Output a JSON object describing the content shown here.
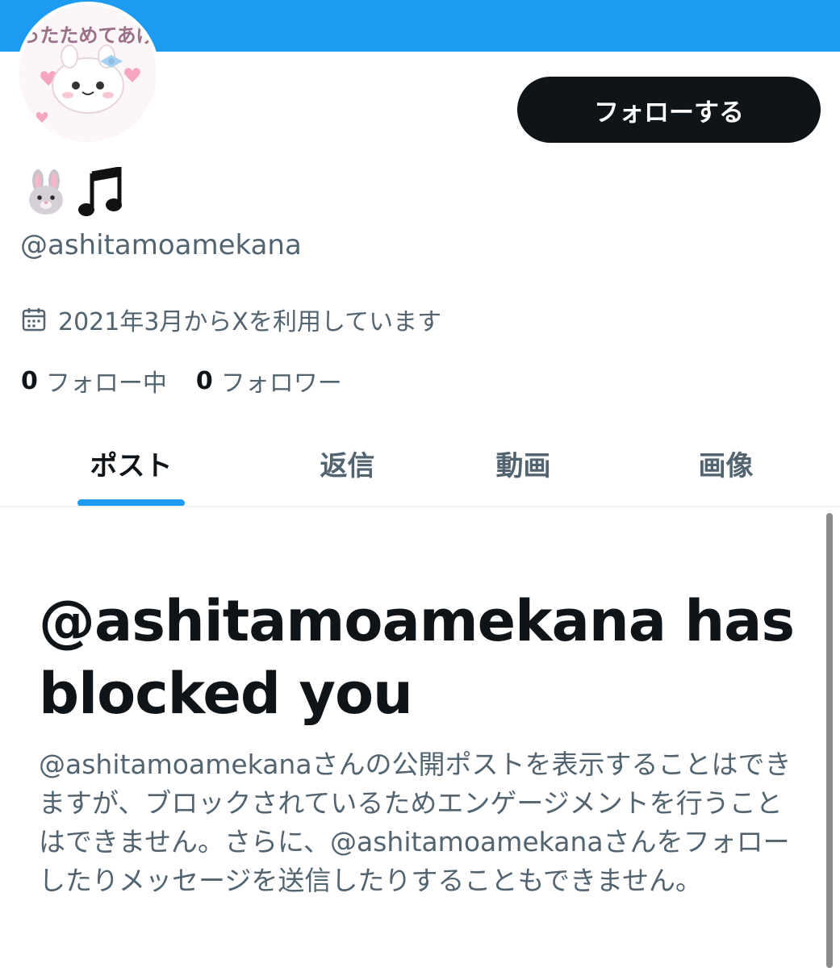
{
  "header": {
    "banner_color": "#1d9bf0"
  },
  "profile": {
    "avatar_text": "あったためてあげる",
    "display_name_icons": [
      "rabbit-face-icon",
      "musical-notes-icon"
    ],
    "handle": "@ashitamoamekana",
    "joined": "2021年3月からXを利用しています",
    "following_count": "0",
    "following_label": "フォロー中",
    "followers_count": "0",
    "followers_label": "フォロワー"
  },
  "actions": {
    "follow_label": "フォローする"
  },
  "tabs": [
    {
      "label": "ポスト",
      "active": true
    },
    {
      "label": "返信",
      "active": false
    },
    {
      "label": "動画",
      "active": false
    },
    {
      "label": "画像",
      "active": false
    }
  ],
  "blocked": {
    "title": "@ashitamoamekana has blocked you",
    "description": "@ashitamoamekanaさんの公開ポストを表示することはできますが、ブロックされているためエンゲージメントを行うことはできません。さらに、@ashitamoamekanaさんをフォローしたりメッセージを送信したりすることもできません。"
  },
  "colors": {
    "accent": "#1d9bf0",
    "text": "#0f1419",
    "secondary": "#536471"
  }
}
